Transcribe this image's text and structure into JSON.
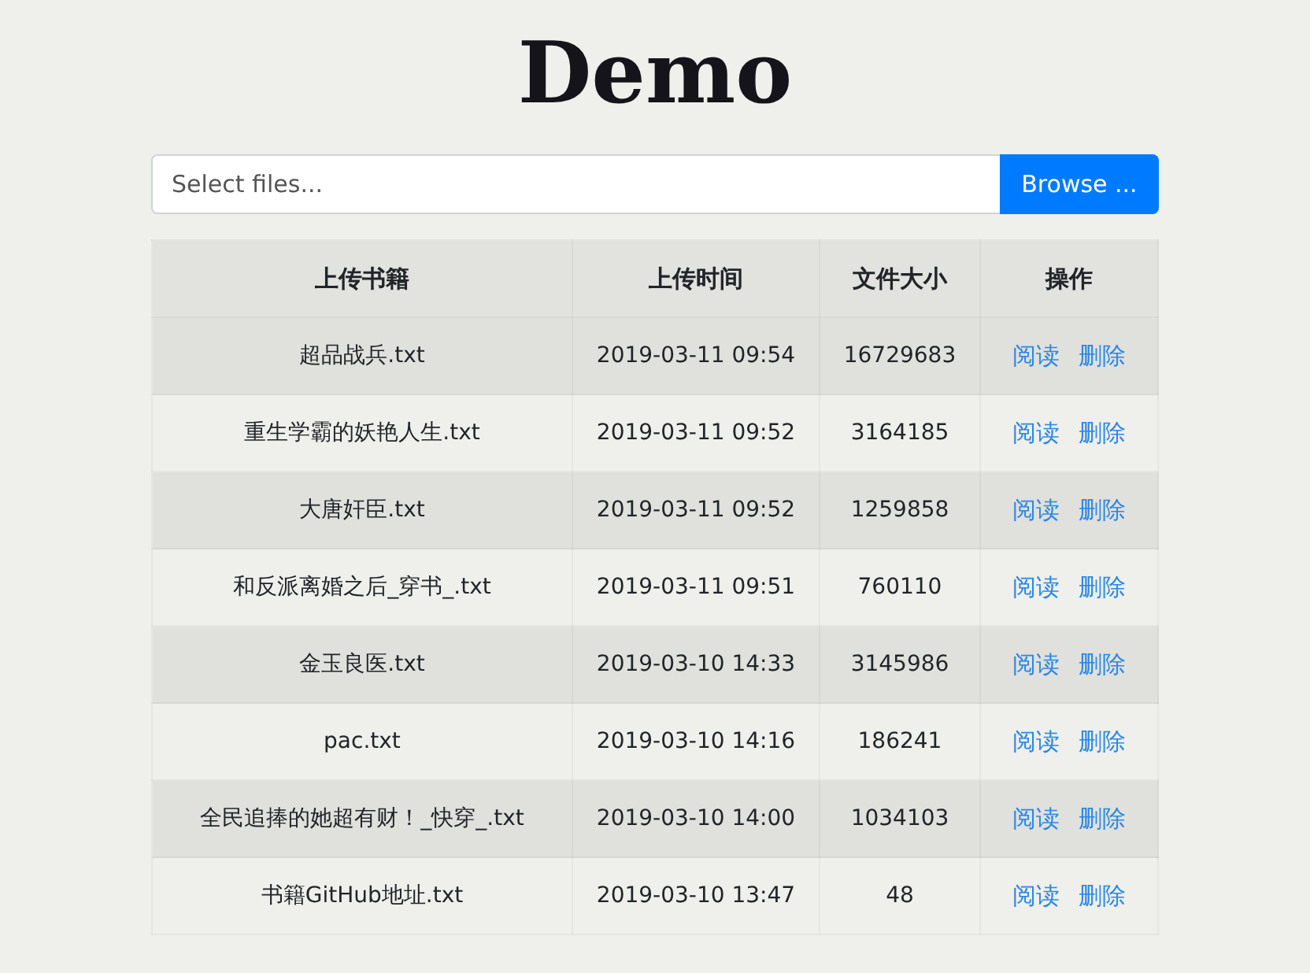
{
  "title": "Demo",
  "file_picker": {
    "placeholder": "Select files...",
    "button": "Browse ..."
  },
  "table": {
    "columns": [
      "上传书籍",
      "上传时间",
      "文件大小",
      "操作"
    ],
    "rows": [
      {
        "name": "超品战兵.txt",
        "time": "2019-03-11 09:54",
        "size": "16729683",
        "actions": [
          "阅读",
          "删除"
        ]
      },
      {
        "name": "重生学霸的妖艳人生.txt",
        "time": "2019-03-11 09:52",
        "size": "3164185",
        "actions": [
          "阅读",
          "删除"
        ]
      },
      {
        "name": "大唐奸臣.txt",
        "time": "2019-03-11 09:52",
        "size": "1259858",
        "actions": [
          "阅读",
          "删除"
        ]
      },
      {
        "name": "和反派离婚之后_穿书_.txt",
        "time": "2019-03-11 09:51",
        "size": "760110",
        "actions": [
          "阅读",
          "删除"
        ]
      },
      {
        "name": "金玉良医.txt",
        "time": "2019-03-10 14:33",
        "size": "3145986",
        "actions": [
          "阅读",
          "删除"
        ]
      },
      {
        "name": "pac.txt",
        "time": "2019-03-10 14:16",
        "size": "186241",
        "actions": [
          "阅读",
          "删除"
        ]
      },
      {
        "name": "全民追捧的她超有财！_快穿_.txt",
        "time": "2019-03-10 14:00",
        "size": "1034103",
        "actions": [
          "阅读",
          "删除"
        ]
      },
      {
        "name": "书籍GitHub地址.txt",
        "time": "2019-03-10 13:47",
        "size": "48",
        "actions": [
          "阅读",
          "删除"
        ]
      }
    ]
  }
}
